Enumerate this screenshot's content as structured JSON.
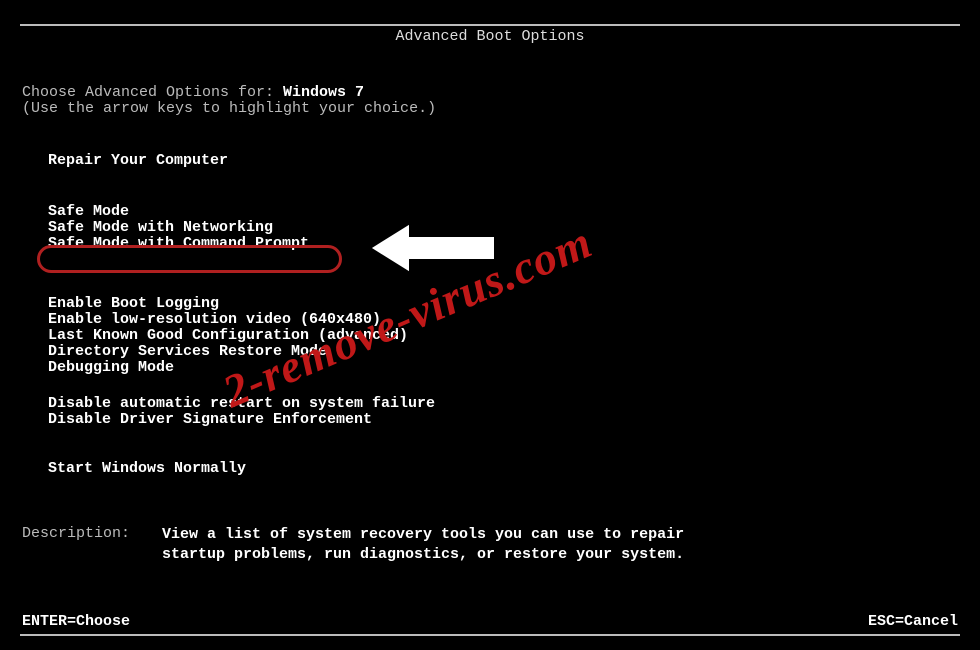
{
  "title": "Advanced Boot Options",
  "prompt_prefix": "Choose Advanced Options for: ",
  "os_name": "Windows 7",
  "instruction": "(Use the arrow keys to highlight your choice.)",
  "menu": {
    "repair": "Repair Your Computer",
    "safe_mode": "Safe Mode",
    "safe_mode_net": "Safe Mode with Networking",
    "safe_mode_cmd": "Safe Mode with Command Prompt",
    "boot_log": "Enable Boot Logging",
    "low_res": "Enable low-resolution video (640x480)",
    "lkg": "Last Known Good Configuration (advanced)",
    "dir_restore": "Directory Services Restore Mode",
    "debug": "Debugging Mode",
    "no_restart": "Disable automatic restart on system failure",
    "no_sig": "Disable Driver Signature Enforcement",
    "normal": "Start Windows Normally"
  },
  "description": {
    "label": "Description:",
    "text": "View a list of system recovery tools you can use to repair startup problems, run diagnostics, or restore your system."
  },
  "footer": {
    "enter": "ENTER=Choose",
    "esc": "ESC=Cancel"
  },
  "watermark": "2-remove-virus.com"
}
